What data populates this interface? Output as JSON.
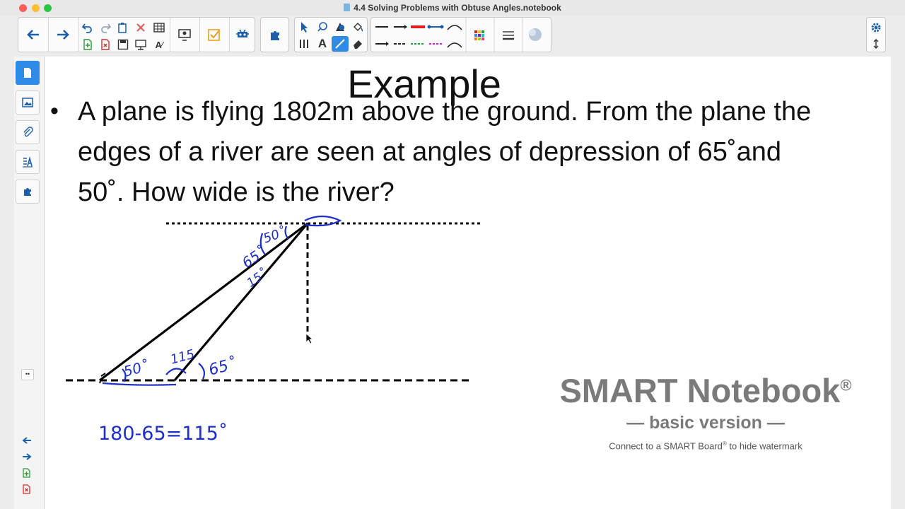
{
  "window": {
    "title": "4.4 Solving Problems with Obtuse Angles.notebook"
  },
  "toolbar": {
    "back_icon": "arrow-left-icon",
    "forward_icon": "arrow-right-icon",
    "undo_icon": "undo-icon",
    "redo_icon": "redo-icon",
    "delete_icon": "delete-icon",
    "accent": "#1d5fa8"
  },
  "slide": {
    "heading": "Example",
    "bullet": "•",
    "question": "A plane is flying 1802m above the ground. From the plane the edges of a river are seen at angles of depression of 65˚and 50˚. How wide is the river?"
  },
  "annotations": {
    "angle_top_50": "50˚",
    "angle_top_65": "65˚",
    "angle_15": "15˚",
    "angle_bottom_50": "50˚",
    "angle_115": "115",
    "angle_bottom_65": "65˚",
    "equation": "180-65=115˚",
    "ink_color": "#1f2fc9"
  },
  "watermark": {
    "title": "SMART Notebook",
    "registered": "®",
    "subtitle": "— basic version —",
    "note_before": "Connect to a SMART Board",
    "note_reg": "®",
    "note_after": " to hide watermark"
  }
}
